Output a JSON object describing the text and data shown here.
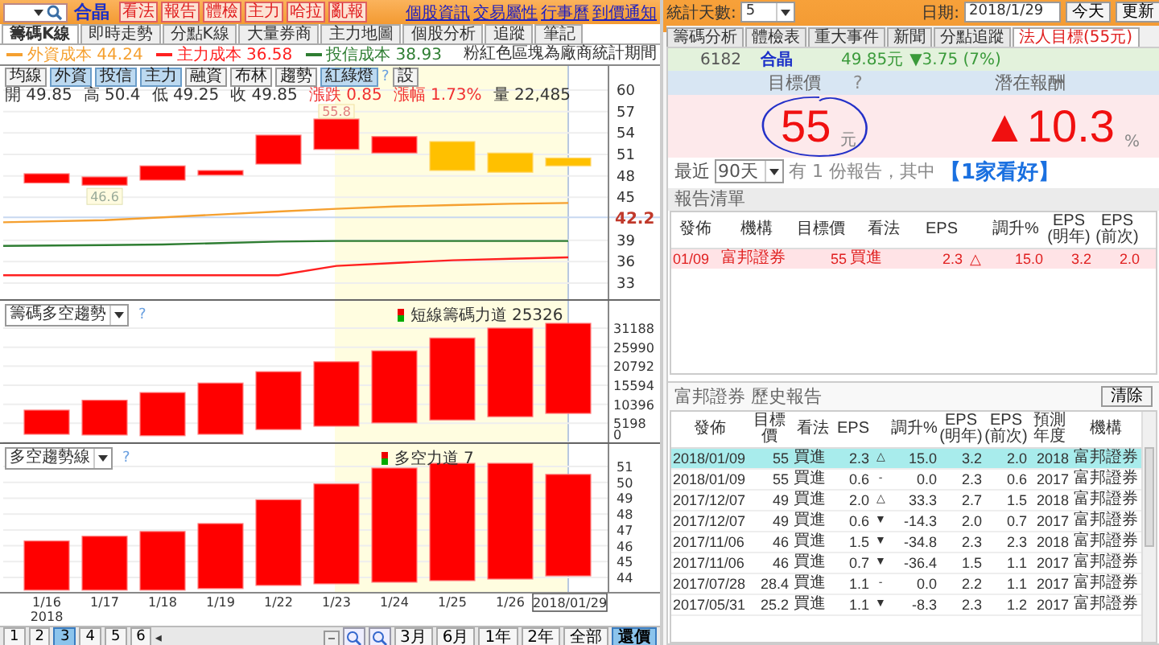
{
  "toolbar": {
    "stock_name": "合晶",
    "actions": [
      "看法",
      "報告",
      "體檢",
      "主力",
      "哈拉",
      "亂報"
    ],
    "links": [
      "個股資訊",
      "交易屬性",
      "行事曆",
      "到價通知"
    ]
  },
  "left_tabs": [
    {
      "label": "籌碼K線",
      "selected": true
    },
    {
      "label": "即時走勢",
      "selected": false
    },
    {
      "label": "分點K線",
      "selected": false
    },
    {
      "label": "大量券商",
      "selected": false
    },
    {
      "label": "主力地圖",
      "selected": false
    },
    {
      "label": "個股分析",
      "selected": false
    },
    {
      "label": "追蹤",
      "selected": false
    },
    {
      "label": "筆記",
      "selected": false
    }
  ],
  "notice": "粉紅色區塊為廠商統計期間",
  "legend": [
    {
      "label": "外資成本 44.24",
      "color": "#f5a030"
    },
    {
      "label": "主力成本 36.58",
      "color": "#ff2020"
    },
    {
      "label": "投信成本 38.93",
      "color": "#2e7d32"
    }
  ],
  "chart_toggles": [
    {
      "label": "均線",
      "on": false
    },
    {
      "label": "外資",
      "on": true
    },
    {
      "label": "投信",
      "on": true
    },
    {
      "label": "主力",
      "on": true
    },
    {
      "label": "融資",
      "on": false
    },
    {
      "label": "布林",
      "on": false
    },
    {
      "label": "趨勢",
      "on": false
    },
    {
      "label": "紅綠燈",
      "on": true
    }
  ],
  "toggle_help": "?",
  "settings": "設",
  "quote": [
    {
      "label": "開",
      "value": "49.85",
      "kind": "plain"
    },
    {
      "label": "高",
      "value": "50.4",
      "kind": "plain"
    },
    {
      "label": "低",
      "value": "49.25",
      "kind": "plain"
    },
    {
      "label": "收",
      "value": "49.85",
      "kind": "plain"
    },
    {
      "label": "漲跌",
      "value": "0.85",
      "kind": "up"
    },
    {
      "label": "漲幅",
      "value": "1.73%",
      "kind": "up"
    },
    {
      "label": "量",
      "value": "22,485",
      "kind": "plain"
    }
  ],
  "price_chart": {
    "y_ticks": [
      "60",
      "57",
      "54",
      "51",
      "48",
      "45",
      "39",
      "36",
      "33"
    ],
    "current_price": "42.2",
    "high_tip": "55.8",
    "low_tip": "46.6"
  },
  "momentum_panel": {
    "selector": "籌碼多空趨勢",
    "help": "?",
    "legend": "短線籌碼力道 25326",
    "y_ticks": [
      "31188",
      "25990",
      "20792",
      "15594",
      "10396",
      "5198",
      "0"
    ]
  },
  "trend_panel": {
    "selector": "多空趨勢線",
    "help": "?",
    "legend": "多空力道 7",
    "y_ticks": [
      "51",
      "50",
      "49",
      "48",
      "47",
      "46",
      "45",
      "44"
    ]
  },
  "x_axis": [
    {
      "label": "1/16",
      "year": "2018"
    },
    {
      "label": "1/17"
    },
    {
      "label": "1/18"
    },
    {
      "label": "1/19"
    },
    {
      "label": "1/22"
    },
    {
      "label": "1/23"
    },
    {
      "label": "1/24"
    },
    {
      "label": "1/25"
    },
    {
      "label": "1/26"
    }
  ],
  "x_axis_current": "2018/01/29",
  "pages": [
    {
      "label": "1",
      "selected": false
    },
    {
      "label": "2",
      "selected": false
    },
    {
      "label": "3",
      "selected": true
    },
    {
      "label": "4",
      "selected": false
    },
    {
      "label": "5",
      "selected": false
    },
    {
      "label": "6",
      "selected": false
    }
  ],
  "pager_arrow": "◂",
  "ranges": [
    {
      "label": "3月",
      "selected": false
    },
    {
      "label": "6月",
      "selected": false
    },
    {
      "label": "1年",
      "selected": false
    },
    {
      "label": "2年",
      "selected": false
    },
    {
      "label": "全部",
      "selected": false
    },
    {
      "label": "還價",
      "selected": true
    }
  ],
  "controls": {
    "days_label": "統計天數:",
    "days": "5",
    "date_label": "日期:",
    "date": "2018/1/29",
    "today": "今天",
    "refresh": "更新"
  },
  "right_tabs": [
    {
      "label": "籌碼分析",
      "selected": false
    },
    {
      "label": "體檢表",
      "selected": false
    },
    {
      "label": "重大事件",
      "selected": false
    },
    {
      "label": "新聞",
      "selected": false
    },
    {
      "label": "分點追蹤",
      "selected": false
    },
    {
      "label": "法人目標(55元)",
      "selected": true
    }
  ],
  "stock_header": {
    "code": "6182",
    "name": "合晶",
    "price": "49.85元",
    "change": "▼3.75 (7%)"
  },
  "target": {
    "label": "目標價",
    "help": "?",
    "value": "55",
    "unit": "元"
  },
  "potential": {
    "label": "潛在報酬",
    "value": "▲10.3",
    "unit": "%"
  },
  "summary": {
    "prefix": "最近",
    "period": "90天",
    "text": "有 1 份報告，其中",
    "highlight": "【1家看好】"
  },
  "report_list": {
    "title": "報告清單",
    "columns": [
      "發佈",
      "機構",
      "目標價",
      "看法",
      "EPS",
      "",
      "調升%",
      "EPS (明年)",
      "EPS (前次)"
    ],
    "rows": [
      {
        "cells": [
          "01/09",
          "富邦證券",
          "55",
          "買進",
          "2.3",
          "△",
          "15.0",
          "3.2",
          "2.0"
        ],
        "selected": true
      }
    ]
  },
  "history": {
    "title": "富邦證券 歷史報告",
    "clear": "清除",
    "columns": [
      "發佈",
      "目標價",
      "看法",
      "EPS",
      "",
      "調升%",
      "EPS (明年)",
      "EPS (前次)",
      "預測年度",
      "機構"
    ],
    "rows": [
      {
        "cells": [
          "2018/01/09",
          "55",
          "買進",
          "2.3",
          "△",
          "15.0",
          "3.2",
          "2.0",
          "2018",
          "富邦證券"
        ],
        "selected": true
      },
      {
        "cells": [
          "2018/01/09",
          "55",
          "買進",
          "0.6",
          "-",
          "0.0",
          "2.3",
          "0.6",
          "2017",
          "富邦證券"
        ],
        "selected": false
      },
      {
        "cells": [
          "2017/12/07",
          "49",
          "買進",
          "2.0",
          "△",
          "33.3",
          "2.7",
          "1.5",
          "2018",
          "富邦證券"
        ],
        "selected": false
      },
      {
        "cells": [
          "2017/12/07",
          "49",
          "買進",
          "0.6",
          "▼",
          "-14.3",
          "2.0",
          "0.7",
          "2017",
          "富邦證券"
        ],
        "selected": false
      },
      {
        "cells": [
          "2017/11/06",
          "46",
          "買進",
          "1.5",
          "▼",
          "-34.8",
          "2.3",
          "2.3",
          "2018",
          "富邦證券"
        ],
        "selected": false
      },
      {
        "cells": [
          "2017/11/06",
          "46",
          "買進",
          "0.7",
          "▼",
          "-36.4",
          "1.5",
          "1.1",
          "2017",
          "富邦證券"
        ],
        "selected": false
      },
      {
        "cells": [
          "2017/07/28",
          "28.4",
          "買進",
          "1.1",
          "-",
          "0.0",
          "2.2",
          "1.1",
          "2017",
          "富邦證券"
        ],
        "selected": false
      },
      {
        "cells": [
          "2017/05/31",
          "25.2",
          "買進",
          "1.1",
          "▼",
          "-8.3",
          "2.3",
          "1.2",
          "2017",
          "富邦證券"
        ],
        "selected": false
      }
    ]
  }
}
